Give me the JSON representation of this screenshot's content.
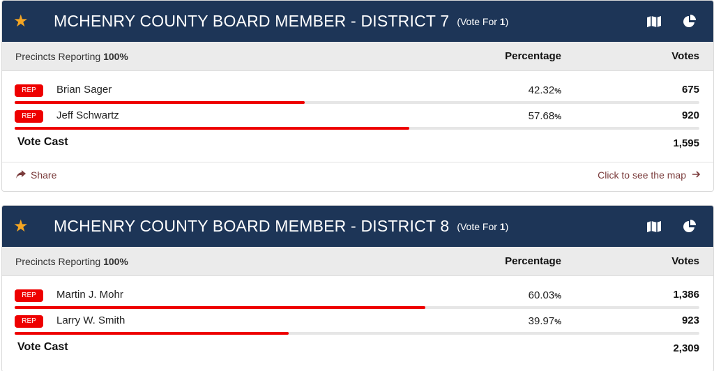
{
  "races": [
    {
      "title": "MCHENRY COUNTY BOARD MEMBER - DISTRICT 7",
      "vote_for_label": "(Vote For ",
      "vote_for_count": "1",
      "vote_for_close": ")",
      "precincts_label": "Precincts Reporting",
      "precincts_value": "100%",
      "percentage_header": "Percentage",
      "votes_header": "Votes",
      "candidates": [
        {
          "party": "REP",
          "name": "Brian Sager",
          "pct": "42.32",
          "pct_sign": "%",
          "votes": "675",
          "share": 0.4232
        },
        {
          "party": "REP",
          "name": "Jeff Schwartz",
          "pct": "57.68",
          "pct_sign": "%",
          "votes": "920",
          "share": 0.5768
        }
      ],
      "total_label": "Vote Cast",
      "total_value": "1,595",
      "share_label": "Share",
      "map_label": "Click to see the map"
    },
    {
      "title": "MCHENRY COUNTY BOARD MEMBER - DISTRICT 8",
      "vote_for_label": "(Vote For ",
      "vote_for_count": "1",
      "vote_for_close": ")",
      "precincts_label": "Precincts Reporting",
      "precincts_value": "100%",
      "percentage_header": "Percentage",
      "votes_header": "Votes",
      "candidates": [
        {
          "party": "REP",
          "name": "Martin J. Mohr",
          "pct": "60.03",
          "pct_sign": "%",
          "votes": "1,386",
          "share": 0.6003
        },
        {
          "party": "REP",
          "name": "Larry W. Smith",
          "pct": "39.97",
          "pct_sign": "%",
          "votes": "923",
          "share": 0.3997
        }
      ],
      "total_label": "Vote Cast",
      "total_value": "2,309"
    }
  ],
  "icons": {
    "favorite": "star-icon",
    "map": "map-icon",
    "chart": "pie-chart-icon",
    "share": "share-arrow-icon",
    "map_link": "arrow-right-icon"
  },
  "colors": {
    "header_bg": "#1d3557",
    "star": "#f5a623",
    "party_rep": "#ee0000",
    "bar_track": "#e6e6e6",
    "link": "#7a3b3b"
  }
}
